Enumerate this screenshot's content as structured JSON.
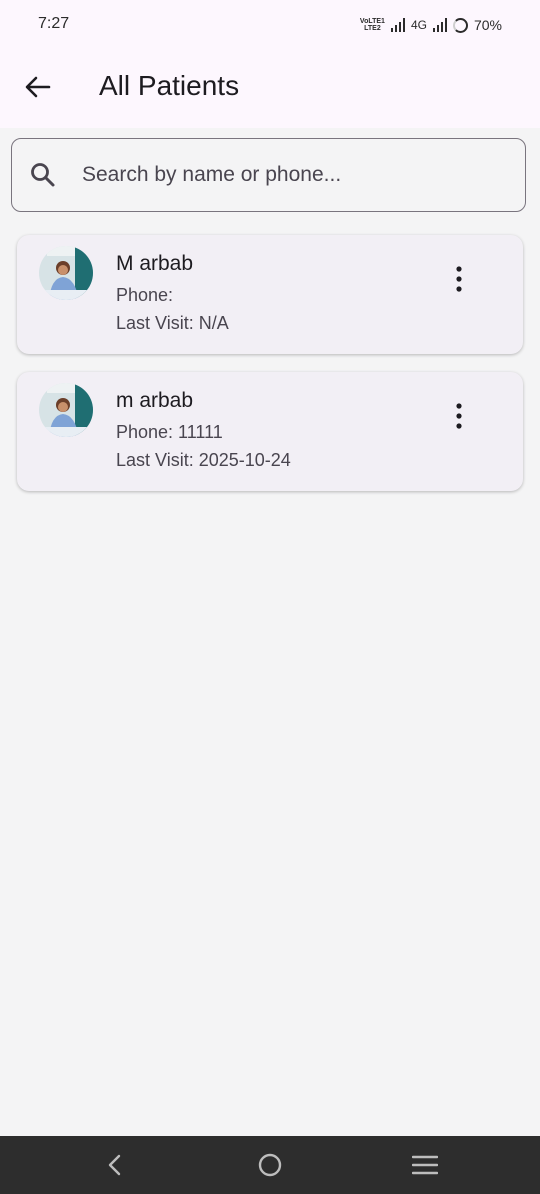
{
  "status_bar": {
    "time": "7:27",
    "volte_line1": "VoLTE1",
    "volte_line2": "LTE2",
    "network": "4G",
    "battery": "70%"
  },
  "app_bar": {
    "title": "All Patients",
    "back_icon": "arrow-left-icon"
  },
  "search": {
    "placeholder": "Search by name or phone...",
    "value": "",
    "icon": "search-icon"
  },
  "patients": [
    {
      "name": "M arbab",
      "phone": "Phone: ",
      "last_visit": "Last Visit: N/A"
    },
    {
      "name": "m arbab",
      "phone": "Phone: 11111",
      "last_visit": "Last Visit: 2025-10-24"
    }
  ],
  "colors": {
    "app_bar_bg": "#fdf7fe",
    "page_bg": "#f4f4f5",
    "card_bg": "#f2eff5",
    "nav_bar_bg": "#2d2d2d"
  },
  "nav": {
    "back_icon": "nav-back-icon",
    "home_icon": "nav-home-icon",
    "menu_icon": "nav-menu-icon"
  }
}
